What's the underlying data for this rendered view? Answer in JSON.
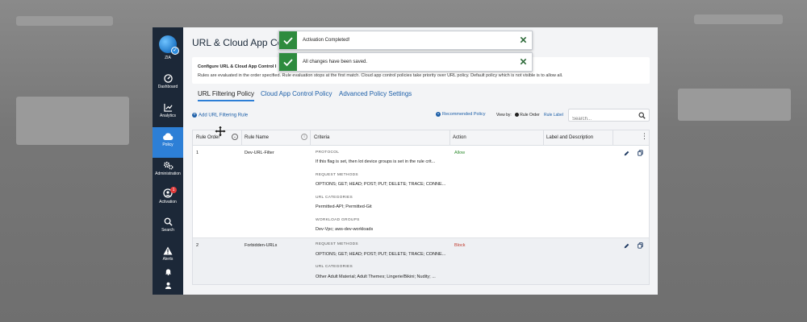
{
  "sidebar": {
    "logo_label": "ZIA",
    "items": [
      {
        "label": "Dashboard",
        "icon": "dashboard-icon"
      },
      {
        "label": "Analytics",
        "icon": "analytics-icon"
      },
      {
        "label": "Policy",
        "icon": "cloud-icon",
        "active": true
      },
      {
        "label": "Administration",
        "icon": "gears-icon"
      },
      {
        "label": "Activation",
        "icon": "activation-icon",
        "badge": "1"
      },
      {
        "label": "Search",
        "icon": "search-icon"
      },
      {
        "label": "Alerts",
        "icon": "alert-icon"
      }
    ]
  },
  "page": {
    "title": "URL & Cloud App Cont"
  },
  "info": {
    "title": "Configure URL & Cloud App Control I",
    "text": "Rules are evaluated in the order specified. Rule evaluation stops at the first match. Cloud app control policies take priority over URL policy. Default policy which is not visible is to allow all."
  },
  "tabs": [
    {
      "label": "URL Filtering Policy",
      "active": true
    },
    {
      "label": "Cloud App Control Policy",
      "active": false
    },
    {
      "label": "Advanced Policy Settings",
      "active": false
    }
  ],
  "toolbar": {
    "add_rule": "Add URL Filtering Rule",
    "recommended": "Recommended Policy",
    "view_by": "View by:",
    "rule_order": "Rule Order",
    "rule_label": "Rule Label",
    "search_placeholder": "Search..."
  },
  "table": {
    "headers": {
      "rule_order": "Rule Order",
      "rule_name": "Rule Name",
      "criteria": "Criteria",
      "action": "Action",
      "label_desc": "Label and Description"
    },
    "rows": [
      {
        "order": "1",
        "name": "Dev-URL-Filter",
        "action": "Allow",
        "criteria": [
          {
            "label": "PROTOCOL",
            "value": "If this flag is set, then lot device groups is set in the rule crit..."
          },
          {
            "label": "REQUEST METHODS",
            "value": "OPTIONS; GET; HEAD; POST; PUT; DELETE; TRACE; CONNE..."
          },
          {
            "label": "URL CATEGORIES",
            "value": "Permitted-API; Permitted-Git"
          },
          {
            "label": "WORKLOAD GROUPS",
            "value": "Dev-Vpc; aws-dev-workloads"
          }
        ]
      },
      {
        "order": "2",
        "name": "Forbidden-URLs",
        "action": "Block",
        "criteria": [
          {
            "label": "REQUEST METHODS",
            "value": "OPTIONS; GET; HEAD; POST; PUT; DELETE; TRACE; CONNE..."
          },
          {
            "label": "URL CATEGORIES",
            "value": "Other Adult Material; Adult Themes; Lingerie/Bikini; Nudity; ..."
          }
        ]
      }
    ]
  },
  "toasts": [
    {
      "message": "Activation Completed!"
    },
    {
      "message": "All changes have been saved."
    }
  ],
  "colors": {
    "sidebar": "#1c2838",
    "accent": "#2d7fd6",
    "success": "#2e8b3e",
    "allow": "#2e8b2e",
    "block": "#c0392b"
  }
}
